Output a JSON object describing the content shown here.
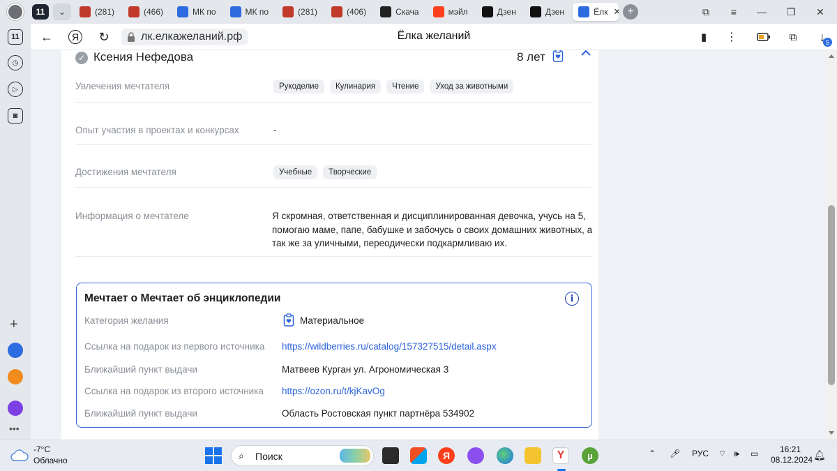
{
  "browser": {
    "tab_count": "11",
    "tabs": [
      {
        "label": "(281)",
        "color": "#c0392b"
      },
      {
        "label": "(466)",
        "color": "#c0392b"
      },
      {
        "label": "МК по",
        "color": "#2d6be0"
      },
      {
        "label": "МК по",
        "color": "#2d6be0"
      },
      {
        "label": "(281)",
        "color": "#c0392b"
      },
      {
        "label": "(406)",
        "color": "#c0392b"
      },
      {
        "label": "Скача",
        "color": "#222222"
      },
      {
        "label": "мэйл",
        "color": "#fc3f1d"
      },
      {
        "label": "Дзен",
        "color": "#111111"
      },
      {
        "label": "Дзен",
        "color": "#111111"
      },
      {
        "label": "Ёлк",
        "color": "#2d6be0",
        "active": true
      }
    ],
    "url": "лк.елкажеланий.рф",
    "page_title": "Ёлка желаний",
    "downloads_badge": "5"
  },
  "dreamer": {
    "name": "Ксения Нефедова",
    "age": "8 лет",
    "hobbies_label": "Увлечения мечтателя",
    "hobbies": [
      "Рукоделие",
      "Кулинария",
      "Чтение",
      "Уход за животными"
    ],
    "experience_label": "Опыт участия в проектах и конкурсах",
    "experience_value": "-",
    "achievements_label": "Достижения мечтателя",
    "achievements": [
      "Учебные",
      "Творческие"
    ],
    "info_label": "Информация о мечтателе",
    "info_text": "Я скромная, ответственная и дисциплинированная девочка, учусь на 5, помогаю маме, папе, бабушке и забочусь о своих домашних животных, а так же за уличными, переодически подкармливаю их."
  },
  "wish": {
    "title": "Мечтает о Мечтает об энциклопедии",
    "category_label": "Категория желания",
    "category_value": "Материальное",
    "link1_label": "Ссылка на подарок из первого источника",
    "link1_value": "https://wildberries.ru/catalog/157327515/detail.aspx",
    "pickup1_label": "Ближайший пункт выдачи",
    "pickup1_value": "Матвеев Курган ул. Агрономическая 3",
    "link2_label": "Ссылка на подарок из второго источника",
    "link2_value": "https://ozon.ru/t/kjKavOg",
    "pickup2_label": "Ближайший пункт выдачи",
    "pickup2_value": "Область Ростовская пункт партнёра 534902",
    "accent_color": "#3a62d8",
    "link_color": "#2b63d9"
  },
  "taskbar": {
    "temperature": "-7°C",
    "condition": "Облачно",
    "search_placeholder": "Поиск",
    "language": "РУС",
    "time": "16:21",
    "date": "08.12.2024"
  }
}
